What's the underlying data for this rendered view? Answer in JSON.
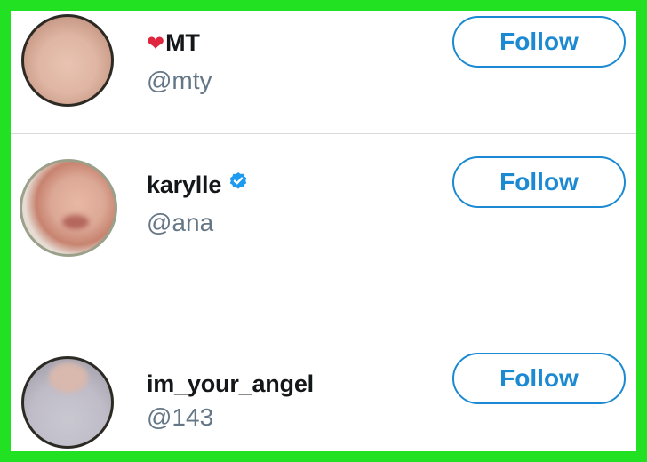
{
  "users": [
    {
      "name": "MT",
      "name_prefix_emoji": "heart-emoji-icon",
      "handle": "@mty",
      "verified": false,
      "follow_label": "Follow"
    },
    {
      "name": "karylle",
      "handle": "@ana",
      "verified": true,
      "verified_icon": "verified-badge-icon",
      "follow_label": "Follow"
    },
    {
      "name": "im_your_angel",
      "handle": "@143",
      "verified": false,
      "follow_label": "Follow"
    }
  ],
  "colors": {
    "accent": "#1b8ad2",
    "frame_border": "#22e022",
    "name_text": "#14171a",
    "handle_text": "#657786",
    "divider": "#d6dadd",
    "heart": "#e0263e"
  }
}
